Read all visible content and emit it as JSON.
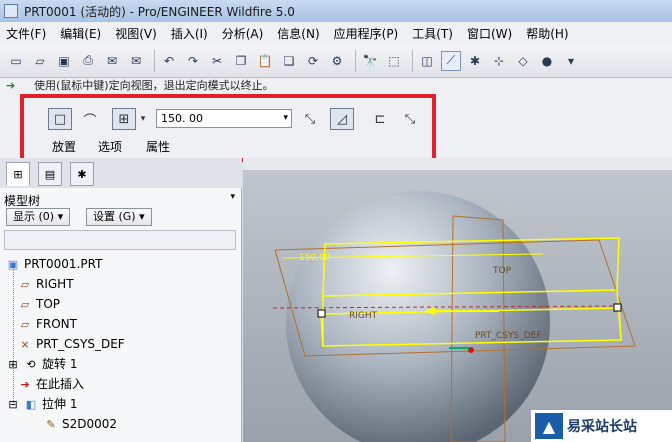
{
  "window": {
    "title": "PRT0001 (活动的) - Pro/ENGINEER Wildfire 5.0"
  },
  "menubar": {
    "items": [
      "文件(F)",
      "编辑(E)",
      "视图(V)",
      "插入(I)",
      "分析(A)",
      "信息(N)",
      "应用程序(P)",
      "工具(T)",
      "窗口(W)",
      "帮助(H)"
    ]
  },
  "message": {
    "text": "使用(鼠标中键)定向视图，退出定向模式以终止。"
  },
  "dashboard": {
    "depth_value": "150. 00",
    "tabs": [
      "放置",
      "选项",
      "属性"
    ]
  },
  "model_tree": {
    "header": "模型树",
    "show_button": "显示 (0) ▾",
    "settings_button": "设置 (G) ▾",
    "items": [
      {
        "label": "PRT0001.PRT",
        "icon": "part-icon"
      },
      {
        "label": "RIGHT",
        "icon": "datum-plane-icon"
      },
      {
        "label": "TOP",
        "icon": "datum-plane-icon"
      },
      {
        "label": "FRONT",
        "icon": "datum-plane-icon"
      },
      {
        "label": "PRT_CSYS_DEF",
        "icon": "csys-icon"
      },
      {
        "label": "旋转 1",
        "icon": "revolve-icon"
      },
      {
        "label": "在此插入",
        "icon": "insert-arrow-icon"
      },
      {
        "label": "拉伸 1",
        "icon": "extrude-icon"
      },
      {
        "label": "S2D0002",
        "icon": "sketch-icon"
      }
    ]
  },
  "viewport": {
    "dimension_label": "150.00",
    "datum_top": "TOP",
    "datum_right": "RIGHT",
    "csys_label": "PRT_CSYS_DEF"
  },
  "watermark": {
    "text": "易采站长站"
  },
  "colors": {
    "highlight_box": "#e0202a",
    "preview_geometry": "#ffff00",
    "sphere": "#a6b0bc"
  }
}
